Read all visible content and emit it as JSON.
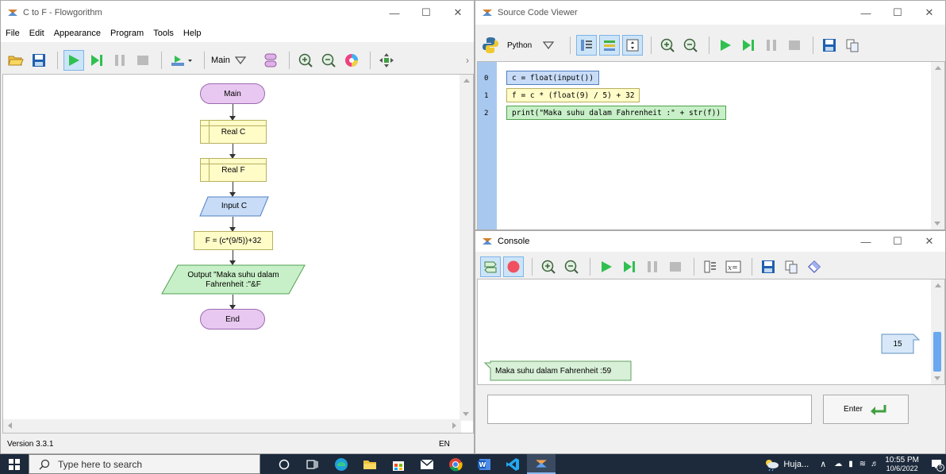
{
  "flowgorithm": {
    "title": "C to F - Flowgorithm",
    "menu": [
      "File",
      "Edit",
      "Appearance",
      "Program",
      "Tools",
      "Help"
    ],
    "function_select": "Main",
    "status_version": "Version 3.3.1",
    "status_lang": "EN",
    "nodes": {
      "main": "Main",
      "real_c": "Real C",
      "real_f": "Real F",
      "input_c": "Input C",
      "assign": "F = (c*(9/5))+32",
      "output_line1": "Output \"Maka suhu dalam",
      "output_line2": "Fahrenheit :\"&F",
      "end": "End"
    }
  },
  "source_viewer": {
    "title": "Source Code Viewer",
    "language": "Python",
    "lines": [
      {
        "num": "0",
        "code": "c = float(input())"
      },
      {
        "num": "1",
        "code": "f = c * (float(9) / 5) + 32"
      },
      {
        "num": "2",
        "code": "print(\"Maka suhu dalam Fahrenheit :\" + str(f))"
      }
    ]
  },
  "console": {
    "title": "Console",
    "user_input": "15",
    "output": "Maka suhu dalam Fahrenheit :59",
    "enter_label": "Enter"
  },
  "taskbar": {
    "search_placeholder": "Type here to search",
    "weather": "Huja...",
    "time": "10:55 PM",
    "date": "10/6/2022",
    "notif_count": "5"
  },
  "colors": {
    "terminal": "#e8c8f0",
    "declare": "#fffcc8",
    "io": "#c8dcf8",
    "output": "#c8f0c8",
    "gutter": "#a8c8f0",
    "taskbar": "#1c2a3c"
  }
}
